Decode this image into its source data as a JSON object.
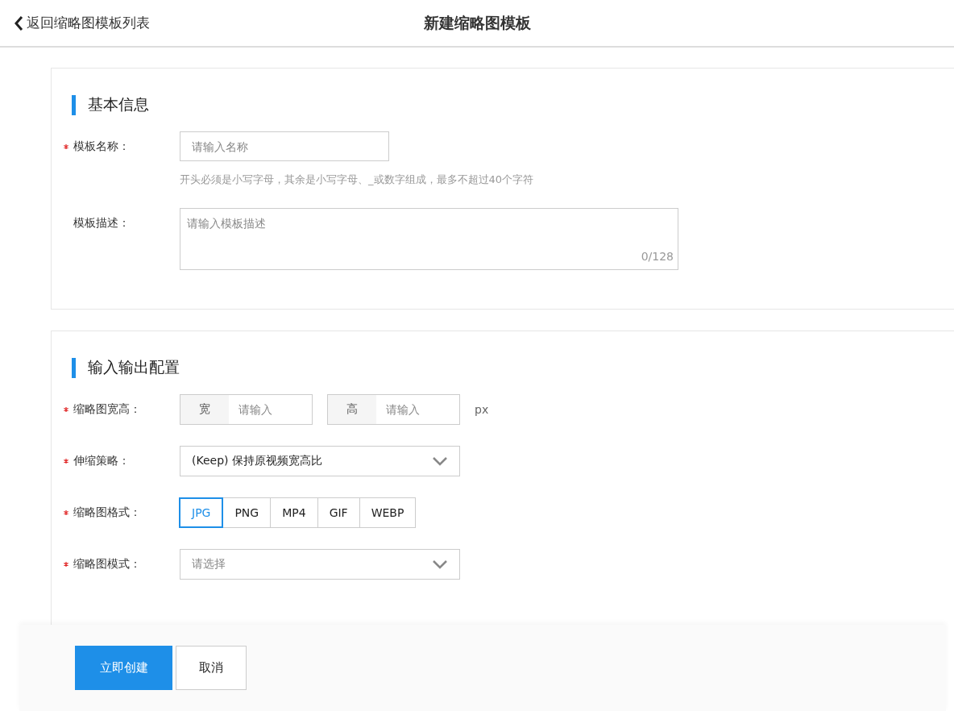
{
  "header": {
    "back_link": "返回缩略图模板列表",
    "title": "新建缩略图模板"
  },
  "sections": [
    {
      "title": "基本信息",
      "fields": [
        {
          "kind": "text",
          "required": true,
          "label": "模板名称：",
          "placeholder": "请输入名称",
          "hint": "开头必须是小写字母，其余是小写字母、_或数字组成，最多不超过40个字符"
        },
        {
          "kind": "textarea",
          "required": false,
          "label": "模板描述：",
          "placeholder": "请输入模板描述",
          "counter": "0/128"
        }
      ]
    },
    {
      "title": "输入输出配置",
      "fields": [
        {
          "kind": "size",
          "required": true,
          "label": "缩略图宽高：",
          "inputs": [
            {
              "addon": "宽",
              "placeholder": "请输入"
            },
            {
              "addon": "高",
              "placeholder": "请输入"
            }
          ],
          "unit": "px"
        },
        {
          "kind": "select",
          "required": true,
          "label": "伸缩策略：",
          "value": "(Keep) 保持原视频宽高比"
        },
        {
          "kind": "segmented",
          "required": true,
          "label": "缩略图格式：",
          "options": [
            {
              "label": "JPG",
              "selected": true
            },
            {
              "label": "PNG",
              "selected": false
            },
            {
              "label": "MP4",
              "selected": false
            },
            {
              "label": "GIF",
              "selected": false
            },
            {
              "label": "WEBP",
              "selected": false
            }
          ]
        },
        {
          "kind": "select",
          "required": true,
          "label": "缩略图模式：",
          "placeholder": "请选择"
        }
      ]
    }
  ],
  "actions": [
    {
      "label": "立即创建",
      "kind": "primary"
    },
    {
      "label": "取消",
      "kind": "default"
    }
  ]
}
